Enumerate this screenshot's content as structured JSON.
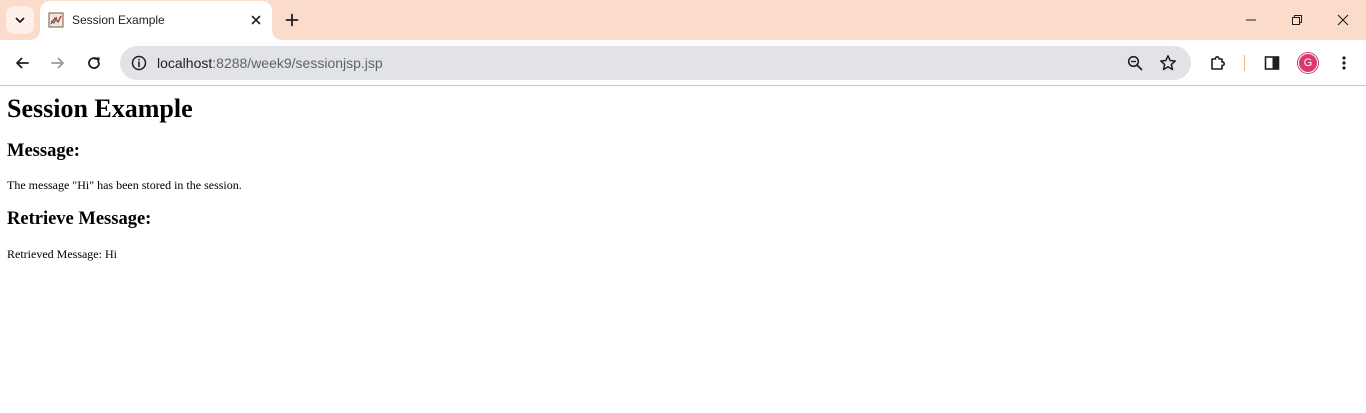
{
  "browser": {
    "tab": {
      "title": "Session Example"
    },
    "address_bar": {
      "url_host": "localhost",
      "url_path": ":8288/week9/sessionjsp.jsp"
    },
    "profile": {
      "initial": "G"
    },
    "colors": {
      "tabstrip_bg": "#fbdccb",
      "omnibox_bg": "#e1e3e6",
      "avatar_bg": "#d93a6e"
    }
  },
  "page": {
    "heading": "Session Example",
    "message_heading": "Message:",
    "message_text": "The message \"Hi\" has been stored in the session.",
    "retrieve_heading": "Retrieve Message:",
    "retrieve_text": "Retrieved Message: Hi"
  }
}
